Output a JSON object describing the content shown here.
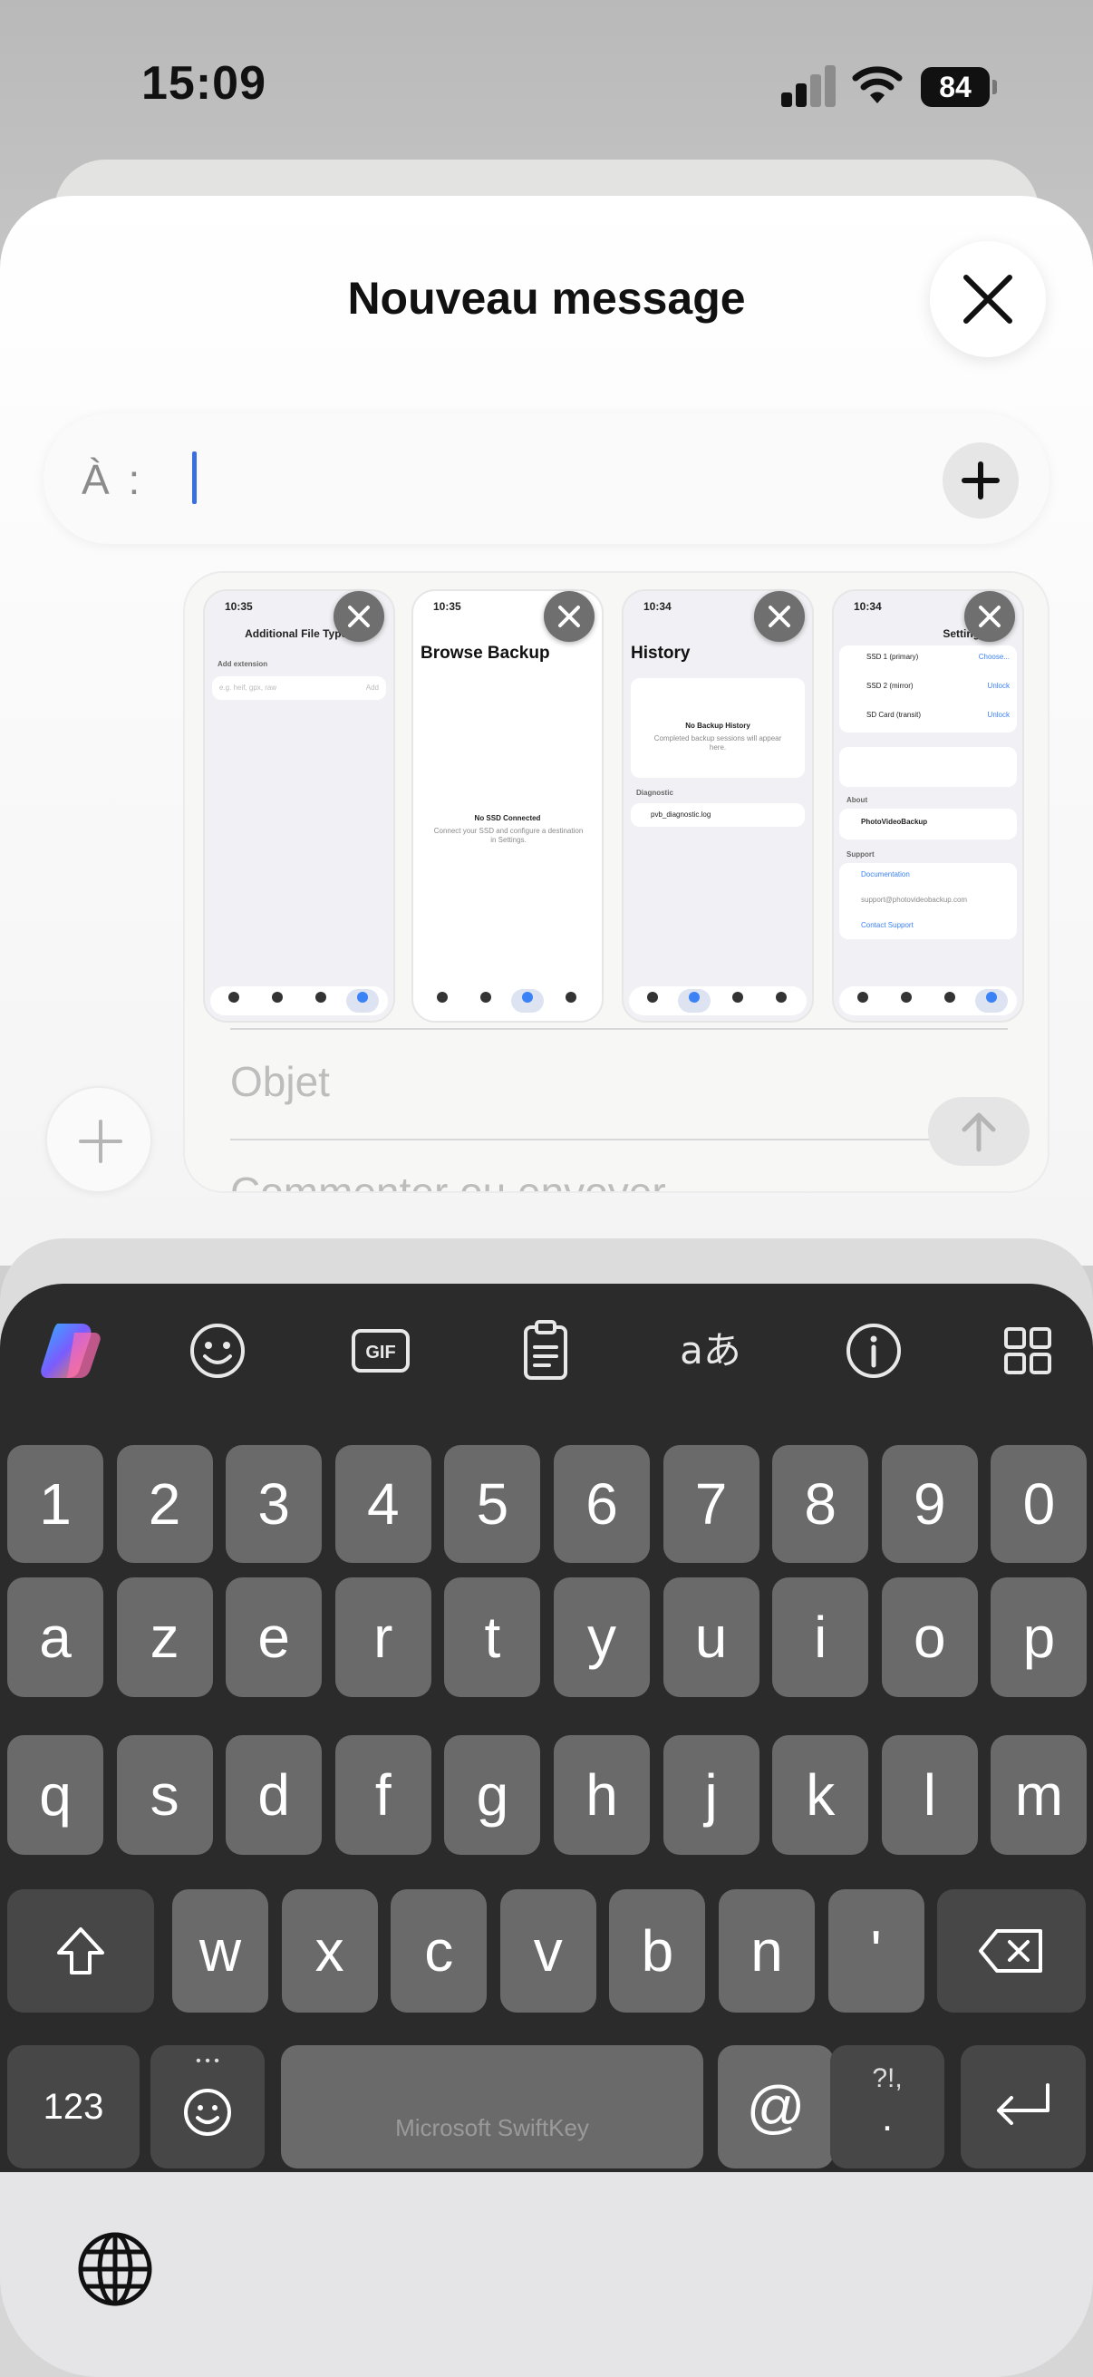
{
  "status_bar": {
    "time": "15:09",
    "battery": "84"
  },
  "compose": {
    "title": "Nouveau message",
    "to_label": "À :",
    "to_value": "",
    "subject_placeholder": "Objet",
    "body_placeholder": "Commenter ou envoyer"
  },
  "attachments": [
    {
      "time": "10:35",
      "title": "Additional File Types",
      "section": "Add extension",
      "placeholder": "e.g. heif, gpx, raw",
      "action": "Add"
    },
    {
      "time": "10:35",
      "title": "Browse Backup",
      "empty_title": "No SSD Connected",
      "empty_text": "Connect your SSD and configure a destination in Settings."
    },
    {
      "time": "10:34",
      "title": "History",
      "empty_title": "No Backup History",
      "empty_text": "Completed backup sessions will appear here.",
      "section": "Diagnostic",
      "file": "pvb_diagnostic.log"
    },
    {
      "time": "10:34",
      "title": "Settings",
      "items": [
        "SSD 1 (primary)",
        "SSD 2 (mirror)",
        "SD Card (transit)"
      ],
      "actions": [
        "Choose...",
        "Unlock",
        "Unlock"
      ],
      "about_label": "About",
      "app_name": "PhotoVideoBackup",
      "support_label": "Support",
      "support_items": [
        "Documentation",
        "support@photovideobackup.com",
        "Contact Support"
      ]
    }
  ],
  "keyboard": {
    "toolbar": [
      "copilot-icon",
      "emoji-icon",
      "gif-icon",
      "clipboard-icon",
      "translate-icon",
      "info-icon",
      "grid-icon"
    ],
    "gif_label": "GIF",
    "translate_label": "aあ",
    "row_numbers": [
      "1",
      "2",
      "3",
      "4",
      "5",
      "6",
      "7",
      "8",
      "9",
      "0"
    ],
    "row1": [
      "a",
      "z",
      "e",
      "r",
      "t",
      "y",
      "u",
      "i",
      "o",
      "p"
    ],
    "row2": [
      "q",
      "s",
      "d",
      "f",
      "g",
      "h",
      "j",
      "k",
      "l",
      "m"
    ],
    "row3": [
      "w",
      "x",
      "c",
      "v",
      "b",
      "n",
      "'"
    ],
    "mode_label": "123",
    "space_label": "Microsoft SwiftKey",
    "at_label": "@",
    "punct_label": "?!,",
    "punct_dot": ".",
    "emoji_dots": "• • •"
  },
  "colors": {
    "caret": "#3a6fe0",
    "keyboard_bg": "#2b2b2b",
    "key": "#6a6a6a",
    "key_dark": "#474747"
  }
}
